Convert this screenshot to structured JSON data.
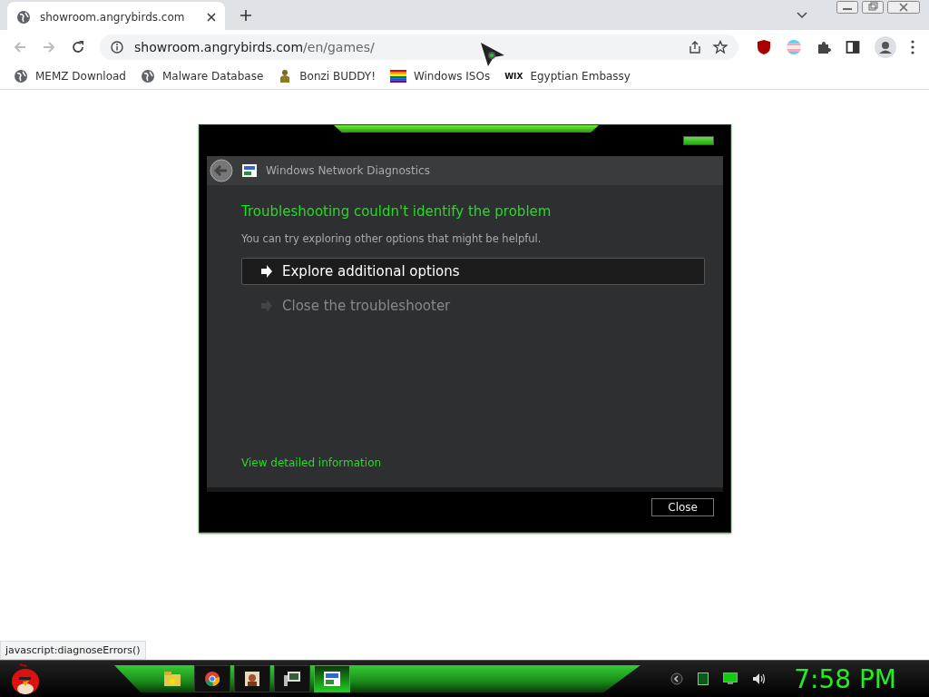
{
  "browser": {
    "tab": {
      "title": "showroom.angrybirds.com"
    },
    "address": {
      "host": "showroom.angrybirds.com",
      "path": "/en/games/"
    },
    "bookmarks": [
      {
        "label": "MEMZ Download",
        "kind": "globe"
      },
      {
        "label": "Malware Database",
        "kind": "globe"
      },
      {
        "label": "Bonzi BUDDY!",
        "kind": "figure"
      },
      {
        "label": "Windows ISOs",
        "kind": "rainbow"
      },
      {
        "label": "Egyptian Embassy",
        "kind": "text",
        "icon_text": "WIX"
      }
    ]
  },
  "dialog": {
    "title": "Windows Network Diagnostics",
    "heading": "Troubleshooting couldn't identify the problem",
    "message": "You can try exploring other options that might be helpful.",
    "options": [
      {
        "label": "Explore additional options",
        "selected": true
      },
      {
        "label": "Close the troubleshooter",
        "selected": false
      }
    ],
    "link": "View detailed information",
    "buttons": [
      "Close"
    ]
  },
  "status_link": "javascript:diagnoseErrors()",
  "taskbar": {
    "apps": [
      {
        "kind": "folder",
        "selected": false
      },
      {
        "kind": "chrome",
        "selected": false
      },
      {
        "kind": "portrait",
        "selected": false
      },
      {
        "kind": "computer",
        "selected": false
      },
      {
        "kind": "network",
        "selected": true
      }
    ],
    "clock": "7:58 PM"
  }
}
